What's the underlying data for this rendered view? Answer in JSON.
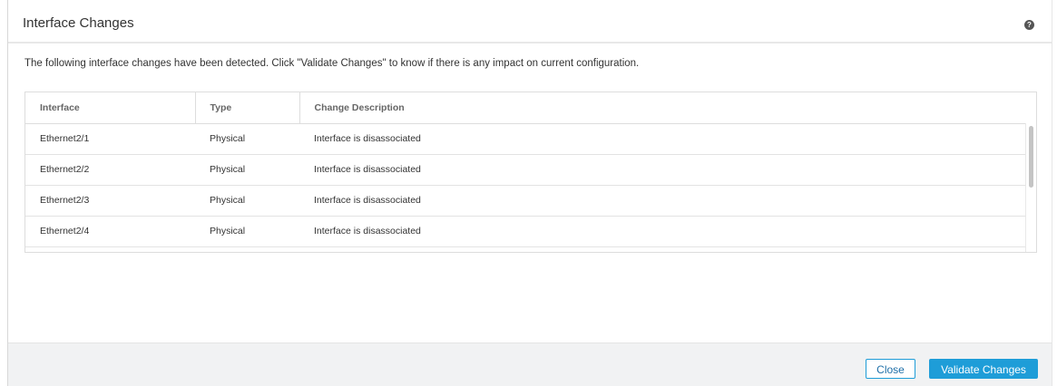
{
  "dialog": {
    "title": "Interface Changes",
    "help_icon": "question-circle-icon",
    "help_glyph": "?",
    "intro": "The following interface changes have been detected. Click \"Validate Changes\" to know if there is any impact on current configuration."
  },
  "table": {
    "columns": [
      "Interface",
      "Type",
      "Change Description"
    ],
    "rows": [
      {
        "interface": "Ethernet2/1",
        "type": "Physical",
        "description": "Interface is disassociated"
      },
      {
        "interface": "Ethernet2/2",
        "type": "Physical",
        "description": "Interface is disassociated"
      },
      {
        "interface": "Ethernet2/3",
        "type": "Physical",
        "description": "Interface is disassociated"
      },
      {
        "interface": "Ethernet2/4",
        "type": "Physical",
        "description": "Interface is disassociated"
      }
    ]
  },
  "footer": {
    "close_label": "Close",
    "validate_label": "Validate Changes"
  },
  "colors": {
    "accent": "#1e9dd8",
    "footer_bg": "#f1f2f3"
  }
}
